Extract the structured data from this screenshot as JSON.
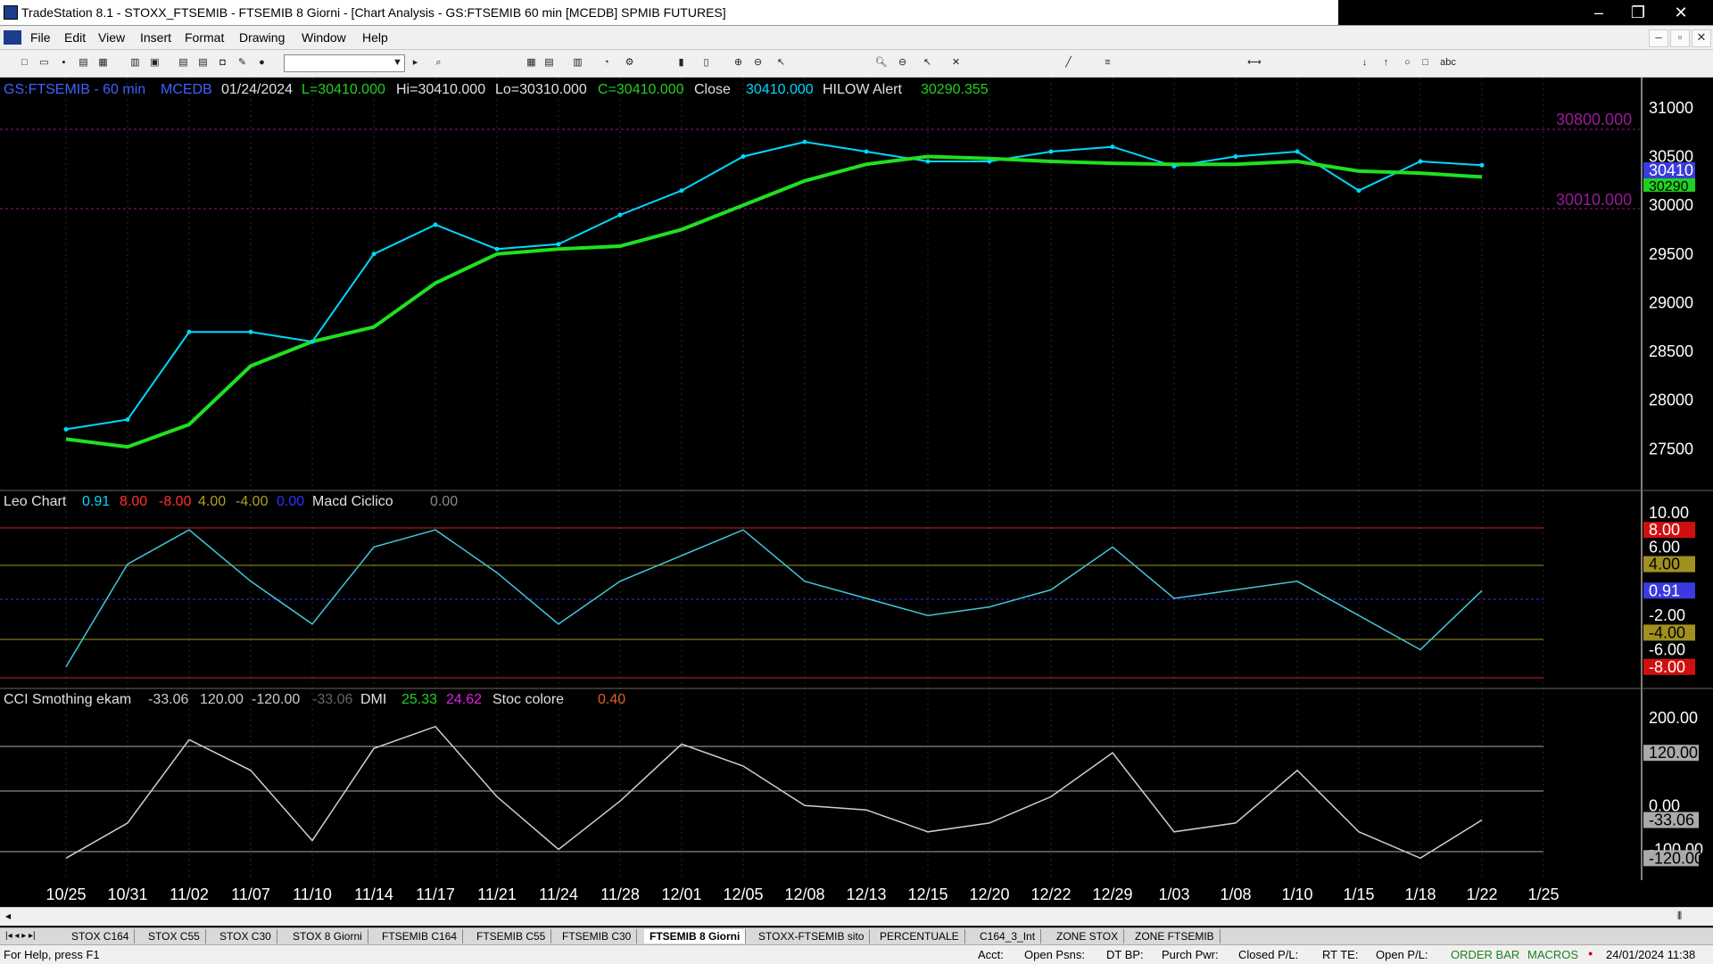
{
  "window": {
    "title": "TradeStation 8.1 - STOXX_FTSEMIB - FTSEMIB  8 Giorni - [Chart Analysis - GS:FTSEMIB  60 min  [MCEDB] SPMIB FUTURES]",
    "minimize": "–",
    "restore": "❐",
    "close": "✕"
  },
  "menu": {
    "items": [
      "File",
      "Edit",
      "View",
      "Insert",
      "Format",
      "Drawing",
      "Window",
      "Help"
    ],
    "mdi_minimize": "–",
    "mdi_restore": "▫",
    "mdi_close": "✕"
  },
  "chart_header": {
    "symbol": "GS:FTSEMIB - 60 min",
    "source": "MCEDB",
    "date": "01/24/2024",
    "last": "L=30410.000",
    "high": "Hi=30410.000",
    "low": "Lo=30310.000",
    "close_val": "C=30410.000",
    "close_label": "Close",
    "close_num": "30410.000",
    "indicator": "HILOW Alert",
    "indicator_val": "30290.355"
  },
  "price_levels": {
    "upper": "30800.000",
    "lower": "30010.000",
    "last_tag": "30410",
    "alert_tag": "30290"
  },
  "price_axis": [
    "31000",
    "30500",
    "30000",
    "29500",
    "29000",
    "28500",
    "28000",
    "27500"
  ],
  "leo": {
    "name": "Leo Chart",
    "v1": "0.91",
    "v2": "8.00",
    "v3": "-8.00",
    "v4": "4.00",
    "v5": "-4.00",
    "v6": "0.00",
    "name2": "Macd Ciclico",
    "v7": "0.00",
    "axis": [
      "10.00",
      "8.00",
      "6.00",
      "4.00",
      "0.91",
      "-2.00",
      "-4.00",
      "-6.00",
      "-8.00"
    ]
  },
  "cci": {
    "name": "CCI Smothing ekam",
    "v1": "-33.06",
    "v2": "120.00",
    "v3": "-120.00",
    "v4": "-33.06",
    "dmi": "DMI",
    "dmi1": "25.33",
    "dmi2": "24.62",
    "stoc": "Stoc colore",
    "stoc_val": "0.40",
    "axis": [
      "200.00",
      "120.00",
      "0.00",
      "-33.06",
      "-100.00",
      "-120.00"
    ]
  },
  "date_axis": [
    "10/25",
    "10/31",
    "11/02",
    "11/07",
    "11/10",
    "11/14",
    "11/17",
    "11/21",
    "11/24",
    "11/28",
    "12/01",
    "12/05",
    "12/08",
    "12/13",
    "12/15",
    "12/20",
    "12/22",
    "12/29",
    "1/03",
    "1/08",
    "1/10",
    "1/15",
    "1/18",
    "1/22",
    "1/25"
  ],
  "tabs": [
    "STOX C164",
    "STOX C55",
    "STOX  C30",
    "STOX  8 Giorni",
    "FTSEMIB C164",
    "FTSEMIB C55",
    "FTSEMIB C30",
    "FTSEMIB  8 Giorni",
    "STOXX-FTSEMIB sito",
    "PERCENTUALE",
    "C164_3_Int",
    "ZONE STOX",
    "ZONE FTSEMIB"
  ],
  "active_tab_index": 7,
  "status": {
    "help": "For Help, press F1",
    "acct": "Acct:",
    "open_psns": "Open Psns:",
    "dt_bp": "DT BP:",
    "purch_pwr": "Purch Pwr:",
    "closed_pl": "Closed P/L:",
    "rt_te": "RT TE:",
    "open_pl": "Open P/L:",
    "order_bar": "ORDER BAR",
    "macros": "MACROS",
    "datetime": "24/01/2024 11:38"
  },
  "chart_data": {
    "type": "line",
    "x": [
      "10/25",
      "10/31",
      "11/02",
      "11/07",
      "11/10",
      "11/14",
      "11/17",
      "11/21",
      "11/24",
      "11/28",
      "12/01",
      "12/05",
      "12/08",
      "12/13",
      "12/15",
      "12/20",
      "12/22",
      "12/29",
      "1/03",
      "1/08",
      "1/10",
      "1/15",
      "1/18",
      "1/22"
    ],
    "ylim": [
      27100,
      31200
    ],
    "series": [
      {
        "name": "GS:FTSEMIB - 60 min",
        "color": "#00d8ff",
        "values": [
          27700,
          27800,
          28700,
          28700,
          28600,
          29500,
          29800,
          29550,
          29600,
          29900,
          30150,
          30500,
          30650,
          30550,
          30450,
          30450,
          30550,
          30600,
          30400,
          30500,
          30550,
          30150,
          30450,
          30410
        ]
      },
      {
        "name": "HILOW Alert",
        "color": "#20e020",
        "values": [
          27600,
          27520,
          27750,
          28350,
          28600,
          28750,
          29200,
          29500,
          29550,
          29580,
          29750,
          30000,
          30250,
          30420,
          30500,
          30480,
          30450,
          30430,
          30420,
          30420,
          30450,
          30350,
          30330,
          30290
        ]
      }
    ],
    "leo_series": [
      {
        "name": "Leo Chart",
        "color": "#40c8d8",
        "values": [
          -8,
          4,
          8,
          2,
          -3,
          6,
          8,
          3,
          -3,
          2,
          5,
          8,
          2,
          0,
          -2,
          -1,
          1,
          6,
          0,
          1,
          2,
          -2,
          -6,
          0.91
        ]
      }
    ],
    "cci_series": [
      {
        "name": "CCI Smothing ekam",
        "color": "#cfcfcf",
        "values": [
          -120,
          -40,
          150,
          80,
          -80,
          130,
          180,
          20,
          -100,
          10,
          140,
          90,
          0,
          -10,
          -60,
          -40,
          20,
          120,
          -60,
          -40,
          80,
          -60,
          -120,
          -33.06
        ]
      }
    ]
  }
}
